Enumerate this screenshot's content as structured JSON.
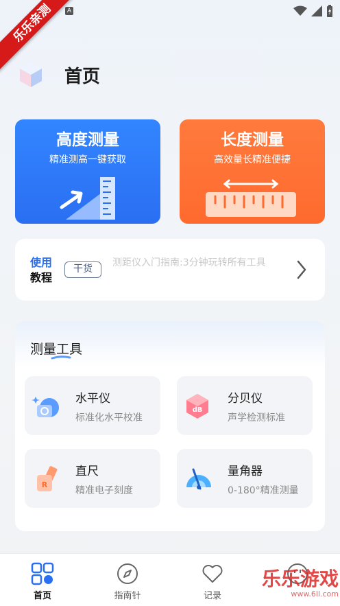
{
  "statusbar": {
    "a_icon": "A",
    "icons": [
      "wifi-icon",
      "signal-icon",
      "battery-charging-icon"
    ]
  },
  "ribbon": {
    "text": "乐乐亲测"
  },
  "header": {
    "title": "首页",
    "logo": "cube-logo-icon"
  },
  "cards": {
    "height": {
      "title": "高度测量",
      "subtitle": "精准测高一键获取",
      "color": "#2a6ff2"
    },
    "length": {
      "title": "长度测量",
      "subtitle": "高效量长精准便捷",
      "color": "#ff6a2e"
    }
  },
  "tutorial": {
    "label_line1": "使用",
    "label_line2": "教程",
    "badge": "干货",
    "text": "测距仪入门指南:3分钟玩转所有工具"
  },
  "tools": {
    "title": "测量工具",
    "items": [
      {
        "name": "水平仪",
        "desc": "标准化水平校准",
        "icon": "level-icon"
      },
      {
        "name": "分贝仪",
        "desc": "声学检测标准",
        "icon": "decibel-icon"
      },
      {
        "name": "直尺",
        "desc": "精准电子刻度",
        "icon": "ruler-icon"
      },
      {
        "name": "量角器",
        "desc": "0-180°精准测量",
        "icon": "protractor-icon"
      }
    ]
  },
  "tabbar": {
    "items": [
      {
        "label": "首页",
        "icon": "home-grid-icon",
        "active": true
      },
      {
        "label": "指南针",
        "icon": "compass-icon",
        "active": false
      },
      {
        "label": "记录",
        "icon": "heart-icon",
        "active": false
      },
      {
        "label": "",
        "icon": "smiley-icon",
        "active": false
      }
    ]
  },
  "watermark": {
    "text": "乐乐游戏",
    "url": "www.6ll.com"
  }
}
